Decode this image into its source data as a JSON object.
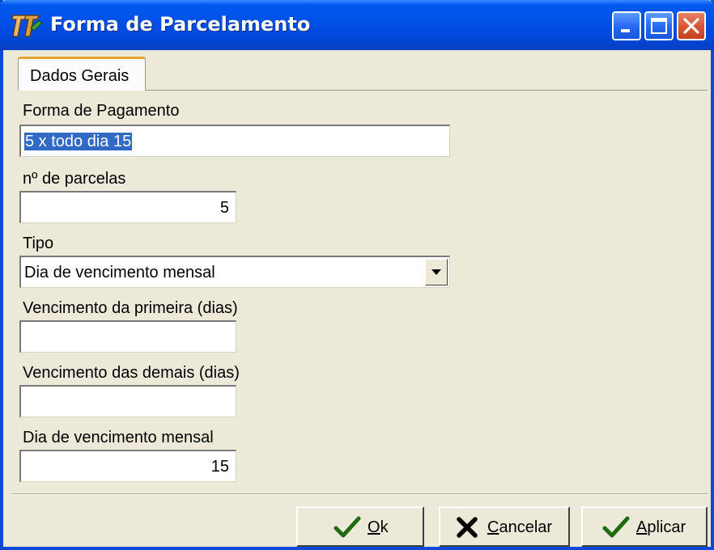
{
  "window": {
    "title": "Forma de Parcelamento",
    "controls": [
      "minimize-icon",
      "maximize-icon",
      "close-icon"
    ]
  },
  "tabs": [
    {
      "label": "Dados Gerais",
      "active": true
    }
  ],
  "form": {
    "forma_pagamento": {
      "label": "Forma de Pagamento",
      "value": "5 x todo dia 15",
      "selected": true
    },
    "num_parcelas": {
      "label": "nº de parcelas",
      "value": "5"
    },
    "tipo": {
      "label": "Tipo",
      "value": "Dia de vencimento mensal"
    },
    "venc_primeira": {
      "label": "Vencimento da primeira (dias)",
      "value": ""
    },
    "venc_demais": {
      "label": "Vencimento das demais (dias)",
      "value": ""
    },
    "dia_venc_mensal": {
      "label": "Dia de vencimento mensal",
      "value": "15"
    }
  },
  "buttons": {
    "ok": {
      "accel": "O",
      "rest": "k",
      "icon": "check-icon"
    },
    "cancel": {
      "accel": "C",
      "rest": "ancelar",
      "icon": "x-icon"
    },
    "apply": {
      "accel": "A",
      "rest": "plicar",
      "icon": "check-icon"
    }
  },
  "colors": {
    "titlebar": "#0050E6",
    "selection": "#316AC5",
    "check": "#1E6B12",
    "tab_highlight": "#E6A52E"
  }
}
